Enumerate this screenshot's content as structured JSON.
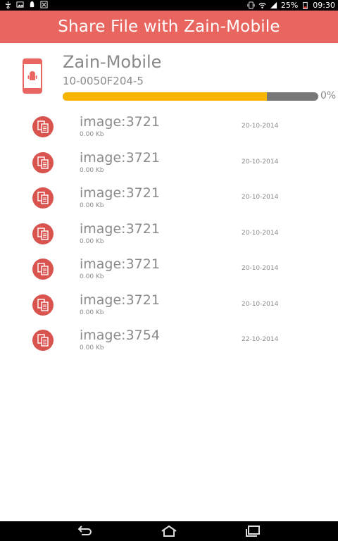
{
  "status_bar": {
    "battery": "25%",
    "time": "09:30"
  },
  "header": {
    "title": "Share File with Zain-Mobile"
  },
  "device": {
    "name": "Zain-Mobile",
    "id": "10-0050F204-5",
    "progress_percent": 80,
    "progress_label": "0%"
  },
  "files": [
    {
      "name": "image:3721",
      "size": "0.00 Kb",
      "date": "20-10-2014"
    },
    {
      "name": "image:3721",
      "size": "0.00 Kb",
      "date": "20-10-2014"
    },
    {
      "name": "image:3721",
      "size": "0.00 Kb",
      "date": "20-10-2014"
    },
    {
      "name": "image:3721",
      "size": "0.00 Kb",
      "date": "20-10-2014"
    },
    {
      "name": "image:3721",
      "size": "0.00 Kb",
      "date": "20-10-2014"
    },
    {
      "name": "image:3721",
      "size": "0.00 Kb",
      "date": "20-10-2014"
    },
    {
      "name": "image:3754",
      "size": "0.00 Kb",
      "date": "22-10-2014"
    }
  ],
  "colors": {
    "header": "#e9655f",
    "progress_fill": "#f7b500",
    "file_icon": "#d9534f"
  }
}
